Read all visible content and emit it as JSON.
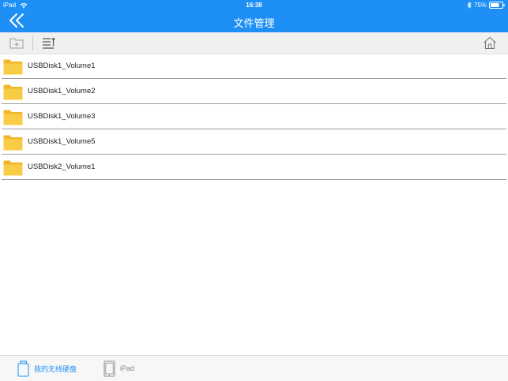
{
  "status_bar": {
    "device": "iPad",
    "time": "16:38",
    "battery": "75%",
    "battery_level": 0.75
  },
  "nav": {
    "title": "文件管理"
  },
  "toolbar": {
    "icons": [
      "new-folder-icon",
      "sort-icon",
      "home-icon"
    ]
  },
  "files": [
    {
      "name": "USBDisk1_Volume1",
      "icon": "folder-icon"
    },
    {
      "name": "USBDisk1_Volume2",
      "icon": "folder-icon"
    },
    {
      "name": "USBDisk1_Volume3",
      "icon": "folder-icon"
    },
    {
      "name": "USBDisk1_Volume5",
      "icon": "folder-icon"
    },
    {
      "name": "USBDisk2_Volume1",
      "icon": "folder-icon"
    }
  ],
  "tabbar": {
    "tabs": [
      {
        "label": "我的无线硬盘",
        "icon": "storage-drive-icon",
        "active": true
      },
      {
        "label": "iPad",
        "icon": "tablet-icon",
        "active": false
      }
    ]
  },
  "colors": {
    "accent": "#1e8ff5",
    "folder": "#f6c936",
    "inactive": "#8a8a8a"
  }
}
